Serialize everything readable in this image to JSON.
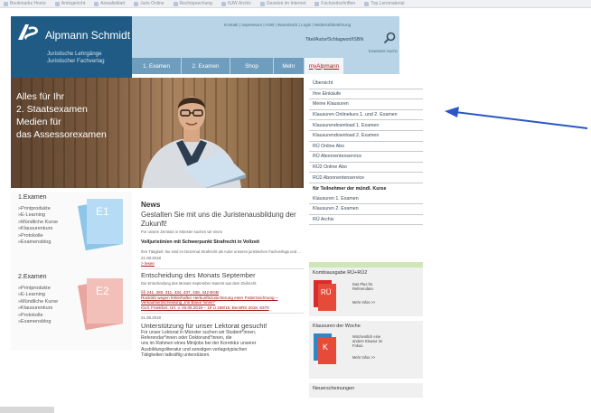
{
  "bookmarks": [
    "Bookmarks Home",
    "Amtsgericht",
    "Anwaltsblatt",
    "Juris Online",
    "Rechtsprechung",
    "NJW Archiv",
    "Gesetze im Internet",
    "Fachzeitschriften",
    "Top Lernmaterial"
  ],
  "logo": {
    "name": "Alpmann Schmidt",
    "sub1": "Juristische Lehrgänge",
    "sub2": "Juristischer Fachverlag"
  },
  "top_links": "Kontakt  |  Impressum  |  AGB  |  Warenkorb  |  Login  |  Widerrufsbelehrung",
  "search": {
    "value": "Titel/Autor/Schlagwort/ISBN",
    "advanced": "Erweiterte Suche"
  },
  "nav": [
    {
      "label": "1. Examen"
    },
    {
      "label": "2. Examen"
    },
    {
      "label": "Shop"
    },
    {
      "label": "Mehr"
    },
    {
      "label": "myAlpmann"
    }
  ],
  "hero": {
    "lines": [
      "Alles für Ihr",
      "2. Staatsexamen",
      "Medien für",
      "das Assessorexamen"
    ]
  },
  "menu": [
    "Übersicht",
    "Ihre Einkäufe",
    "Meine Klausuren",
    "Klausuren Onlinekurs 1. und 2. Examen",
    "Klausurendownload 1. Examen",
    "Klausurendownload 2. Examen",
    "RÜ Online Abo",
    "RÜ Abonnentenservice",
    "RÜ2 Online Abo",
    "RÜ2 Abonnentenservice",
    "für Teilnehmer der mündl. Kurse",
    "Klausuren 1. Examen",
    "Klausuren 2. Examen",
    "RÜ Archiv"
  ],
  "left": [
    {
      "title": "1.Examen",
      "links": [
        "»Printprodukte",
        "»E-Learning",
        "»Mündliche Kurse",
        "»Klausurenkurs",
        "»Protokolle",
        "»Examensblog"
      ]
    },
    {
      "title": "2.Examen",
      "links": [
        "»Printprodukte",
        "»E-Learning",
        "»Mündliche Kurse",
        "»Klausurenkurs",
        "»Protokolle",
        "»Examensblog"
      ]
    }
  ],
  "news": {
    "heading": "News",
    "item1_title": "Gestalten Sie mit uns die Juristenausbildung der Zukunft!",
    "item1_sub": "Für unsere Zentrale in Münster suchen wir einen",
    "item1_bold": "Volljuristin/en mit Schwerpunkt Strafrecht in Vollzeit",
    "item1_desc": "Ihre Tätigkeit: Sie sind im Dezernat Strafrecht als Autor unseres juristischen Fachverlags und ...",
    "item1_date": "21.08.2018",
    "item1_link": "> lesen",
    "item2_title": "Entscheidung des Monats September",
    "item2_sub": "Die Entscheidung des Monats September stammt aus dem Zivilrecht.",
    "item2_ref1": "§§ 241, 280, 311, 434, 437, 438, 442 BGB",
    "item2_ref2": "Rücktritt wegen fehlerhafter Herkunftszusicherung einer Federzeichnung – Verkaufsentscheidung „Ins Blaue hinein“",
    "item2_ref3": "OLG Frankfurt, Urt. v. 03.05.2018 – 19 U 188/15, BeckRS 2018, 8370",
    "item3_date": "21.08.2018",
    "item3_title": "Unterstützung für unser Lektorat gesucht!",
    "item3_body": [
      "Für unser Lektorat in Münster suchen wir Student*innen,",
      "Referendar*innen oder Doktorand*innen, die",
      "uns im Rahmen eines Minijobs bei der Korrektur unserer",
      "Ausbildungsliteratur und sonstigen verlagstypischen",
      "Tätigkeiten tatkräftig unterstützen."
    ]
  },
  "sidebar": {
    "block1_title": "Kombiausgabe RÜ+RÜ2",
    "block1_text": "Das Plus für Referendare.",
    "block1_link": "Mehr Infos >>",
    "block1_book": "RÜ",
    "block2_title": "Klausuren der Woche",
    "block2_text": "Wöchentlich eine andere Klausur im Fokus.",
    "block2_link": "Mehr Infos >>",
    "block2_book": "K",
    "block3_title": "Neuerscheinungen"
  },
  "colors": {
    "brand": "#1f5b85",
    "nav": "#6e9dbd",
    "accent_red": "#a21a1a",
    "arrow": "#2a56c6"
  }
}
